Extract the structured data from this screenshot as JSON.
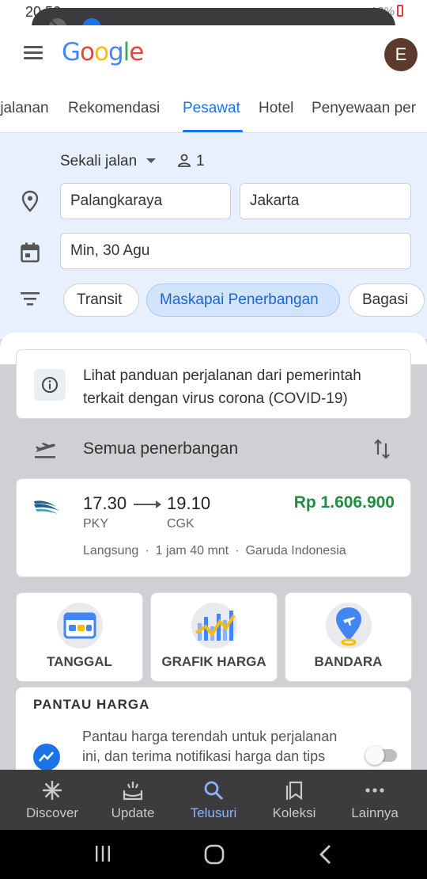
{
  "status_bar": {
    "time": "20.52",
    "battery": "13%"
  },
  "logo": {
    "parts": [
      "G",
      "o",
      "o",
      "g",
      "l",
      "e"
    ]
  },
  "avatar": {
    "initial": "E"
  },
  "tabs": [
    {
      "label": "rjalanan"
    },
    {
      "label": "Rekomendasi"
    },
    {
      "label": "Pesawat"
    },
    {
      "label": "Hotel"
    },
    {
      "label": "Penyewaan per"
    }
  ],
  "search": {
    "trip_type": "Sekali jalan",
    "passengers": "1",
    "origin": "Palangkaraya",
    "destination": "Jakarta",
    "date": "Min, 30 Agu",
    "filters": [
      {
        "label": "Transit"
      },
      {
        "label": "Maskapai Penerbangan"
      },
      {
        "label": "Bagasi"
      }
    ]
  },
  "covid_notice": "Lihat panduan perjalanan dari pemerintah terkait dengan virus corona (COVID-19)",
  "all_flights_label": "Semua penerbangan",
  "flight": {
    "depart_time": "17.30",
    "arrive_time": "19.10",
    "depart_code": "PKY",
    "arrive_code": "CGK",
    "price": "Rp 1.606.900",
    "stops": "Langsung",
    "duration": "1 jam 40 mnt",
    "airline": "Garuda Indonesia"
  },
  "tiles": [
    {
      "label": "TANGGAL"
    },
    {
      "label": "GRAFIK HARGA"
    },
    {
      "label": "BANDARA"
    }
  ],
  "price_watch": {
    "heading": "PANTAU HARGA",
    "description": "Pantau harga terendah untuk perjalanan ini, dan terima notifikasi harga dan tips"
  },
  "bottom_nav": [
    {
      "label": "Discover",
      "icon": "discover-icon"
    },
    {
      "label": "Update",
      "icon": "update-icon"
    },
    {
      "label": "Telusuri",
      "icon": "search-icon"
    },
    {
      "label": "Koleksi",
      "icon": "collections-icon"
    },
    {
      "label": "Lainnya",
      "icon": "more-icon"
    }
  ],
  "colors": {
    "accent": "#1a73e8",
    "price": "#1e8e3e",
    "panel": "#e8f0fe"
  }
}
